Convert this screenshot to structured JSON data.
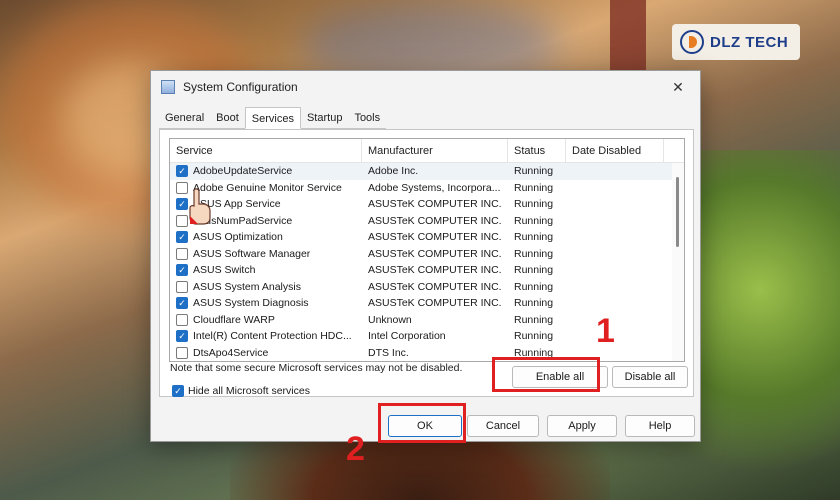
{
  "brand": {
    "name": "DLZ TECH"
  },
  "window": {
    "title": "System Configuration",
    "close_glyph": "✕"
  },
  "tabs": [
    "General",
    "Boot",
    "Services",
    "Startup",
    "Tools"
  ],
  "active_tab": "Services",
  "columns": {
    "service": "Service",
    "manufacturer": "Manufacturer",
    "status": "Status",
    "date_disabled": "Date Disabled"
  },
  "services": [
    {
      "name": "AdobeUpdateService",
      "manufacturer": "Adobe Inc.",
      "status": "Running",
      "checked": true
    },
    {
      "name": "Adobe Genuine Monitor Service",
      "manufacturer": "Adobe Systems, Incorpora...",
      "status": "Running",
      "checked": false
    },
    {
      "name": "ASUS App Service",
      "manufacturer": "ASUSTeK COMPUTER INC.",
      "status": "Running",
      "checked": true
    },
    {
      "name": "AsusNumPadService",
      "manufacturer": "ASUSTeK COMPUTER INC.",
      "status": "Running",
      "checked": false
    },
    {
      "name": "ASUS Optimization",
      "manufacturer": "ASUSTeK COMPUTER INC.",
      "status": "Running",
      "checked": true
    },
    {
      "name": "ASUS Software Manager",
      "manufacturer": "ASUSTeK COMPUTER INC.",
      "status": "Running",
      "checked": false
    },
    {
      "name": "ASUS Switch",
      "manufacturer": "ASUSTeK COMPUTER INC.",
      "status": "Running",
      "checked": true
    },
    {
      "name": "ASUS System Analysis",
      "manufacturer": "ASUSTeK COMPUTER INC.",
      "status": "Running",
      "checked": false
    },
    {
      "name": "ASUS System Diagnosis",
      "manufacturer": "ASUSTeK COMPUTER INC.",
      "status": "Running",
      "checked": true
    },
    {
      "name": "Cloudflare WARP",
      "manufacturer": "Unknown",
      "status": "Running",
      "checked": false
    },
    {
      "name": "Intel(R) Content Protection HDC...",
      "manufacturer": "Intel Corporation",
      "status": "Running",
      "checked": true
    },
    {
      "name": "DtsApo4Service",
      "manufacturer": "DTS Inc.",
      "status": "Running",
      "checked": false
    }
  ],
  "note": "Note that some secure Microsoft services may not be disabled.",
  "buttons": {
    "enable_all": "Enable all",
    "disable_all": "Disable all",
    "ok": "OK",
    "cancel": "Cancel",
    "apply": "Apply",
    "help": "Help"
  },
  "hide_ms": {
    "label": "Hide all Microsoft services",
    "checked": true
  },
  "annotations": {
    "step1": "1",
    "step2": "2",
    "color": "#e02020"
  },
  "accent_color": "#1e6fc6"
}
